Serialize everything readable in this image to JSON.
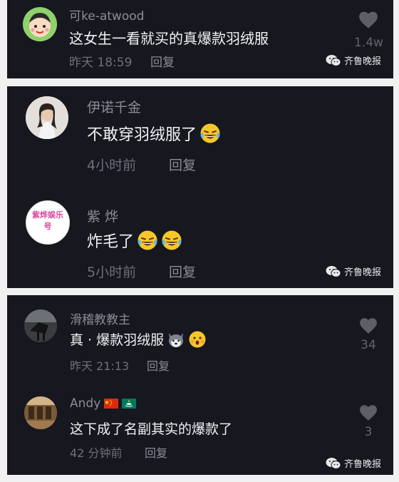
{
  "watermark": "齐鲁晚报",
  "panel1": {
    "username": "可ke-atwood",
    "comment": "这女生一看就买的真爆款羽绒服",
    "time": "昨天 18:59",
    "reply": "回复",
    "likes": "1.4w"
  },
  "panel2": {
    "c1": {
      "username": "伊诺千金",
      "comment": "不敢穿羽绒服了",
      "time": "4小时前",
      "reply": "回复"
    },
    "c2": {
      "username": "紫 烨",
      "avatar_text": "紫烨娱乐号",
      "comment": "炸毛了",
      "time": "5小时前",
      "reply": "回复"
    }
  },
  "panel3": {
    "c1": {
      "username": "滑稽教教主",
      "comment": "真 · 爆款羽绒服",
      "time": "昨天 21:13",
      "reply": "回复",
      "likes": "34"
    },
    "c2": {
      "username": "Andy",
      "comment": "这下成了名副其实的爆款了",
      "time": "42 分钟前",
      "reply": "回复",
      "likes": "3"
    }
  }
}
